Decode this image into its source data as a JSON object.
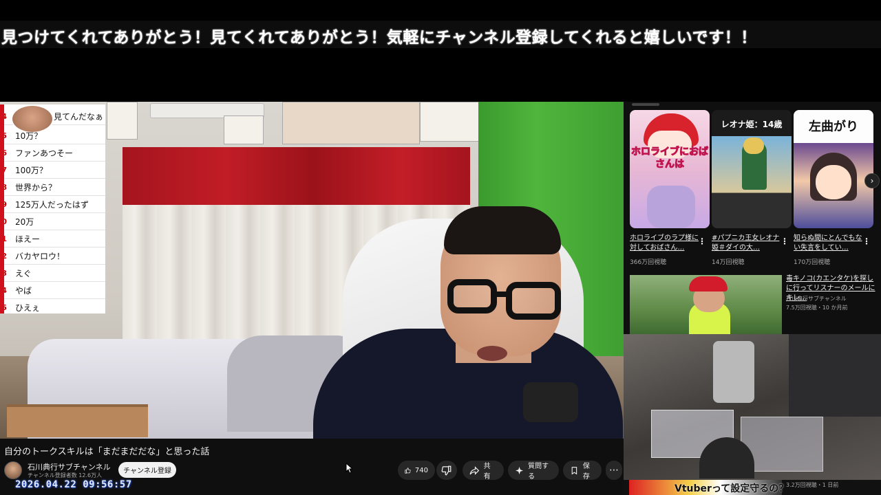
{
  "banner": {
    "text": "見つけてくれてありがとう！見てくれてありがとう！気軽にチャンネル登録してくれると嬉しいです！！"
  },
  "comments": [
    {
      "num": "4",
      "text": "見てんだなぁ"
    },
    {
      "num": "5",
      "text": "10万？"
    },
    {
      "num": "6",
      "text": "ファンあつそー"
    },
    {
      "num": "7",
      "text": "100万？"
    },
    {
      "num": "8",
      "text": "世界から？"
    },
    {
      "num": "9",
      "text": "125万人だったはず"
    },
    {
      "num": "0",
      "text": "20万"
    },
    {
      "num": "1",
      "text": "ほえー"
    },
    {
      "num": "2",
      "text": "バカヤロウ！"
    },
    {
      "num": "3",
      "text": "えぐ"
    },
    {
      "num": "4",
      "text": "やば"
    },
    {
      "num": "5",
      "text": "ひえぇ"
    }
  ],
  "video": {
    "title": "自分のトークスキルは「まだまだだな」と思った話",
    "channel_name": "石川典行サブチャンネル",
    "subscribers": "チャンネル登録者数 12.6万人",
    "subscribe_label": "チャンネル登録",
    "timestamp": "2026.04.22  09:56:57"
  },
  "actions": {
    "like_count": "740",
    "share": "共有",
    "thanks": "質問する",
    "save": "保存"
  },
  "shorts": [
    {
      "caption": "ホロライブのラプ様に対しておばさん…",
      "views": "366万回視聴",
      "thumb_text": "ホロライブにおばさんは"
    },
    {
      "caption": "#パプニカ王女レオナ姫＃ダイの大…",
      "views": "14万回視聴",
      "thumb_text": "レオナ姫：14歳"
    },
    {
      "caption": "知らぬ間にとんでもない失言をしてい…",
      "views": "170万回視聴",
      "thumb_text": "左曲がり"
    }
  ],
  "recommended": {
    "title": "毒キノコ(カエンタケ)を探しに行ってリスナーのメールにキレ…",
    "channel": "石川典行サブチャンネル",
    "meta": "7.5万回視聴・10 か月前"
  },
  "bottom": {
    "thumb_text": "Vtuberって設定守るの？",
    "meta": "3.2万回視聴・1 日前"
  },
  "colors": {
    "accent": "#c11d26",
    "background": "#0f0f0f",
    "chat_border": "#d0101a"
  },
  "icons": [
    "like-icon",
    "dislike-icon",
    "share-icon",
    "sparkle-icon",
    "save-icon",
    "more-icon",
    "chevron-right-icon"
  ]
}
